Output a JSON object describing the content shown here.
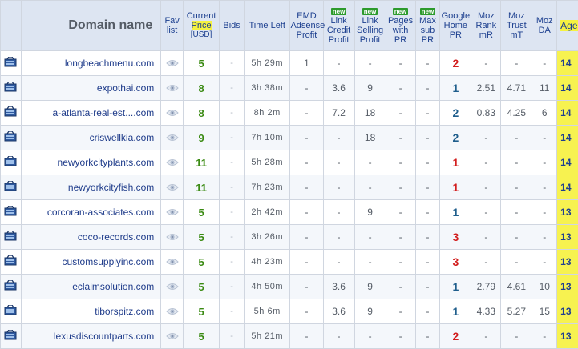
{
  "header": {
    "domain": "Domain name",
    "fav": "Fav list",
    "price_top": "Current",
    "price_label": "Price",
    "price_unit": "[USD]",
    "bids": "Bids",
    "time_left": "Time Left",
    "emd": "EMD Adsense Profit",
    "new_badge": "new",
    "link_credit": "Link Credit Profit",
    "link_selling": "Link Selling Profit",
    "pages_pr": "Pages with PR",
    "max_sub": "Max sub PR",
    "google_pr": "Google Home PR",
    "moz_rank": "Moz Rank mR",
    "moz_trust": "Moz Trust mT",
    "moz_da": "Moz DA",
    "age": "Age"
  },
  "dash": "-",
  "rows": [
    {
      "domain": "longbeachmenu.com",
      "price": "5",
      "time": "5h 29m",
      "emd": "1",
      "credit": "-",
      "selling": "-",
      "pages": "-",
      "maxsub": "-",
      "pr": "2",
      "pr_color": "red",
      "mr": "-",
      "mt": "-",
      "da": "-",
      "age": "14"
    },
    {
      "domain": "expothai.com",
      "price": "8",
      "time": "3h 38m",
      "emd": "-",
      "credit": "3.6",
      "selling": "9",
      "pages": "-",
      "maxsub": "-",
      "pr": "1",
      "pr_color": "blue",
      "mr": "2.51",
      "mt": "4.71",
      "da": "11",
      "age": "14"
    },
    {
      "domain": "a-atlanta-real-est....com",
      "price": "8",
      "time": "8h 2m",
      "emd": "-",
      "credit": "7.2",
      "selling": "18",
      "pages": "-",
      "maxsub": "-",
      "pr": "2",
      "pr_color": "blue",
      "mr": "0.83",
      "mt": "4.25",
      "da": "6",
      "age": "14"
    },
    {
      "domain": "criswellkia.com",
      "price": "9",
      "time": "7h 10m",
      "emd": "-",
      "credit": "-",
      "selling": "18",
      "pages": "-",
      "maxsub": "-",
      "pr": "2",
      "pr_color": "blue",
      "mr": "-",
      "mt": "-",
      "da": "-",
      "age": "14"
    },
    {
      "domain": "newyorkcityplants.com",
      "price": "11",
      "time": "5h 28m",
      "emd": "-",
      "credit": "-",
      "selling": "-",
      "pages": "-",
      "maxsub": "-",
      "pr": "1",
      "pr_color": "red",
      "mr": "-",
      "mt": "-",
      "da": "-",
      "age": "14"
    },
    {
      "domain": "newyorkcityfish.com",
      "price": "11",
      "time": "7h 23m",
      "emd": "-",
      "credit": "-",
      "selling": "-",
      "pages": "-",
      "maxsub": "-",
      "pr": "1",
      "pr_color": "red",
      "mr": "-",
      "mt": "-",
      "da": "-",
      "age": "14"
    },
    {
      "domain": "corcoran-associates.com",
      "price": "5",
      "time": "2h 42m",
      "emd": "-",
      "credit": "-",
      "selling": "9",
      "pages": "-",
      "maxsub": "-",
      "pr": "1",
      "pr_color": "blue",
      "mr": "-",
      "mt": "-",
      "da": "-",
      "age": "13"
    },
    {
      "domain": "coco-records.com",
      "price": "5",
      "time": "3h 26m",
      "emd": "-",
      "credit": "-",
      "selling": "-",
      "pages": "-",
      "maxsub": "-",
      "pr": "3",
      "pr_color": "red",
      "mr": "-",
      "mt": "-",
      "da": "-",
      "age": "13"
    },
    {
      "domain": "customsupplyinc.com",
      "price": "5",
      "time": "4h 23m",
      "emd": "-",
      "credit": "-",
      "selling": "-",
      "pages": "-",
      "maxsub": "-",
      "pr": "3",
      "pr_color": "red",
      "mr": "-",
      "mt": "-",
      "da": "-",
      "age": "13"
    },
    {
      "domain": "eclaimsolution.com",
      "price": "5",
      "time": "4h 50m",
      "emd": "-",
      "credit": "3.6",
      "selling": "9",
      "pages": "-",
      "maxsub": "-",
      "pr": "1",
      "pr_color": "blue",
      "mr": "2.79",
      "mt": "4.61",
      "da": "10",
      "age": "13"
    },
    {
      "domain": "tiborspitz.com",
      "price": "5",
      "time": "5h 6m",
      "emd": "-",
      "credit": "3.6",
      "selling": "9",
      "pages": "-",
      "maxsub": "-",
      "pr": "1",
      "pr_color": "blue",
      "mr": "4.33",
      "mt": "5.27",
      "da": "15",
      "age": "13"
    },
    {
      "domain": "lexusdiscountparts.com",
      "price": "5",
      "time": "5h 21m",
      "emd": "-",
      "credit": "-",
      "selling": "-",
      "pages": "-",
      "maxsub": "-",
      "pr": "2",
      "pr_color": "red",
      "mr": "-",
      "mt": "-",
      "da": "-",
      "age": "13"
    }
  ],
  "icons": {
    "cart": "shopping-cart-icon",
    "eye": "eye-icon"
  },
  "colors": {
    "header_bg": "#dde5f2",
    "highlight": "#f5f241",
    "price_green": "#3a8a12",
    "pr_red": "#d21d1d",
    "pr_blue": "#1f5e8c",
    "new_badge": "#2c9a2c"
  }
}
